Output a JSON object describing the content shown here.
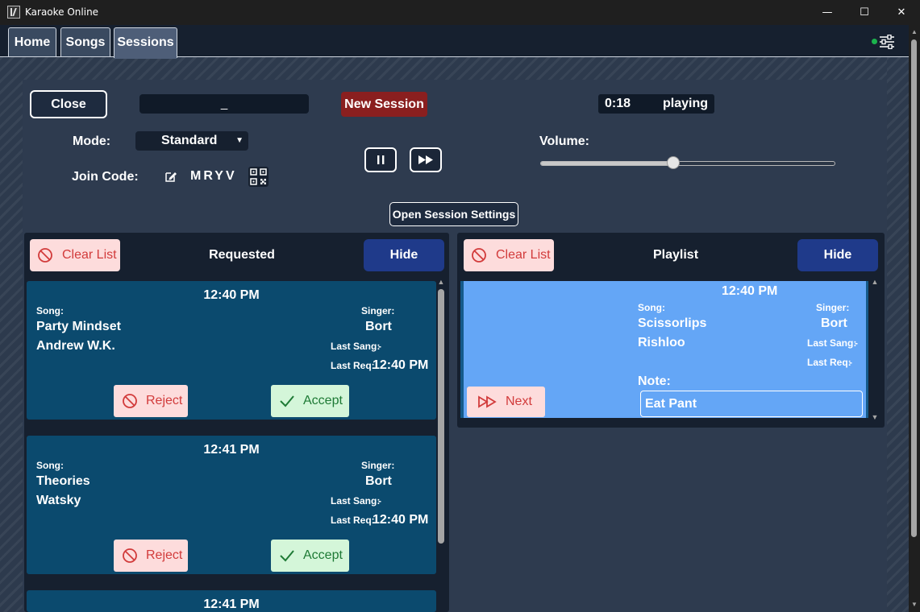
{
  "window": {
    "title": "Karaoke Online",
    "minimize_glyph": "—",
    "maximize_glyph": "☐",
    "close_glyph": "✕"
  },
  "tabs": [
    {
      "label": "Home"
    },
    {
      "label": "Songs"
    },
    {
      "label": "Sessions",
      "active": true
    }
  ],
  "header": {
    "status_icon": "online-status-dot",
    "settings_icon": "sliders-icon"
  },
  "session": {
    "close_label": "Close",
    "code_value": "_",
    "new_session_label": "New Session",
    "time": "0:18",
    "state": "playing",
    "mode_label": "Mode:",
    "mode_value": "Standard",
    "join_code_label": "Join Code:",
    "join_code": "MRYV",
    "volume_label": "Volume:",
    "volume_level": 0.45,
    "open_settings_label": "Open Session Settings"
  },
  "requested": {
    "title": "Requested",
    "clear_label": "Clear List",
    "hide_label": "Hide",
    "cards": [
      {
        "time": "12:40 PM",
        "song_label": "Song:",
        "song": "Party Mindset",
        "artist": "Andrew W.K.",
        "singer_label": "Singer:",
        "singer": "Bort",
        "last_sang_label": "Last Sang:",
        "last_sang": "-",
        "last_req_label": "Last Req:",
        "last_req": "12:40 PM",
        "reject_label": "Reject",
        "accept_label": "Accept"
      },
      {
        "time": "12:41 PM",
        "song_label": "Song:",
        "song": "Theories",
        "artist": "Watsky",
        "singer_label": "Singer:",
        "singer": "Bort",
        "last_sang_label": "Last Sang:",
        "last_sang": "-",
        "last_req_label": "Last Req:",
        "last_req": "12:40 PM",
        "reject_label": "Reject",
        "accept_label": "Accept"
      },
      {
        "time": "12:41 PM"
      }
    ]
  },
  "playlist": {
    "title": "Playlist",
    "clear_label": "Clear List",
    "hide_label": "Hide",
    "cards": [
      {
        "time": "12:40 PM",
        "song_label": "Song:",
        "song": "Scissorlips",
        "artist": "Rishloo",
        "singer_label": "Singer:",
        "singer": "Bort",
        "last_sang_label": "Last Sang:",
        "last_sang": "-",
        "last_req_label": "Last Req:",
        "last_req": "-",
        "note_label": "Note:",
        "note": "Eat Pant",
        "next_label": "Next"
      }
    ]
  },
  "colors": {
    "accent_red": "#8a1f1f",
    "hide_blue": "#1f3a8a",
    "card_blue": "#0b4a6e",
    "playing_card": "#64a6f6"
  }
}
